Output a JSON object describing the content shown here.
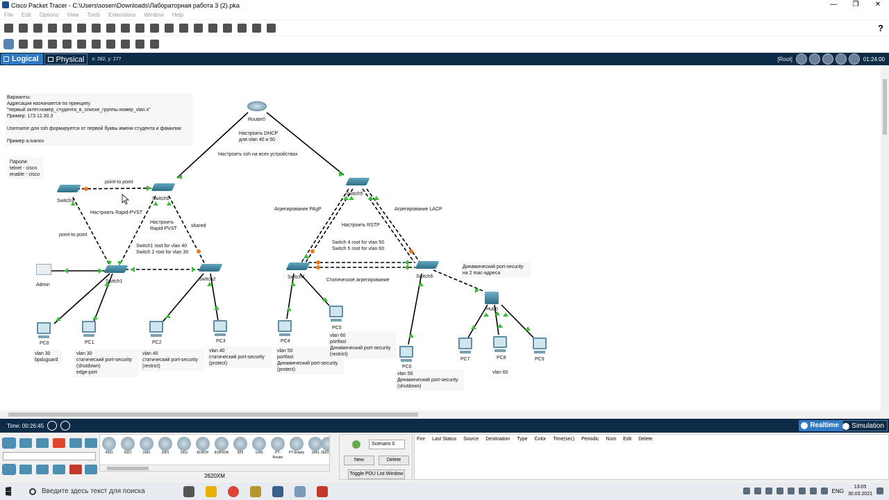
{
  "window": {
    "title": "Cisco Packet Tracer - C:\\Users\\sosen\\Downloads\\Лабораторная работа 3 (2).pka",
    "minimize": "—",
    "maximize": "❐",
    "close": "✕"
  },
  "menu": [
    "File",
    "Edit",
    "Options",
    "View",
    "Tools",
    "Extensions",
    "Window",
    "Help"
  ],
  "toolbar": {
    "help": "?"
  },
  "mode": {
    "logical": "Logical",
    "physical": "Physical",
    "coords": "x: 282, y: 277",
    "root": "[Root]",
    "clock": "01:24:00"
  },
  "devices": {
    "router0": "Router0",
    "switch0": "Switch0",
    "switch1": "Switch1",
    "switch2": "Switch2",
    "switch3": "Switch3",
    "switch4": "Switch4",
    "switch5": "Switch5",
    "switch6": "Switch6",
    "hub0": "Hub0",
    "admin": "Admin",
    "pc0": "PC0",
    "pc1": "PC1",
    "pc2": "PC2",
    "pc3": "PC3",
    "pc4": "PC4",
    "pc5": "PC5",
    "pc6": "PC6",
    "pc7": "PC7",
    "pc8": "PC8",
    "pc9": "PC9"
  },
  "notes": {
    "variants": "Варианты:\nАдресация назначается по принципу\n\"первый октет.номер_студента_в_списке_группы.номер_vlan.x\"\nПример: 173.12.30.3\n\nUsername для ssh формируется от первой буквы имени студента и фамилии\n\nПример a.ivanov",
    "passwords": "Пароли:\ntelnet - cisco\nenable - cisco",
    "dhcp": "Настроить DHCP\nдля vlan 40 и 50",
    "ssh": "Настроить ssh на всех устройствах",
    "p2p_top": "point-to point",
    "rapid1": "Настроить Rapid-PVST",
    "rapid2": "Настроить\nRapid-PVST",
    "shared": "shared",
    "p2p_left": "point-to point",
    "root_vlans": "Switch1 root for vlan 40\nSwitch 2 root for vlan 30",
    "pagp": "Агрегирование PAgP",
    "lacp": "Агрегирование LACP",
    "rstp": "Настроить RSTP",
    "root_vlans2": "Switch 4 root for vlan 50\nSwitch 5 root for vlan 60",
    "static_agg": "Статическое агрегирование",
    "dyn_ps": "Динамический port-security\nна 2 mac-адреса",
    "pc0": "vlan 30\nbpduguard",
    "pc1": "vlan 30\nстатический port-security\n(shutdown)\nedge-port",
    "pc2": "vlan 40\nстатический port-security\n(restrict)",
    "pc3": "vlan 40\nстатический port-security\n(protect)",
    "pc4": "vlan 50\nportfast\nДинамический port-security\n(protect)",
    "pc5": "vlan 60\nportfast\nДинамический port-security\n(restrict)",
    "pc6": "vlan 50\nДинамический port-security\n(shutdown)",
    "pc8": "vlan 60"
  },
  "status": {
    "time": "Time: 00:26:45",
    "realtime": "Realtime",
    "simulation": "Simulation"
  },
  "bottom": {
    "models": [
      "4331",
      "4321",
      "1941",
      "2901",
      "2911",
      "819IOX",
      "819HGW",
      "829",
      "1240",
      "PT-Router",
      "PT-Empty",
      "1841",
      "2620XM"
    ],
    "model_name": "2620XM",
    "scenario": "Scenario 0",
    "new": "New",
    "delete": "Delete",
    "toggle": "Toggle PDU List Window",
    "pdu_cols": [
      "Fire",
      "Last Status",
      "Source",
      "Destination",
      "Type",
      "Color",
      "Time(sec)",
      "Periodic",
      "Num",
      "Edit",
      "Delete"
    ]
  },
  "taskbar": {
    "search": "Введите здесь текст для поиска",
    "lang": "ENG",
    "time": "13:05",
    "date": "30.03.2021"
  }
}
